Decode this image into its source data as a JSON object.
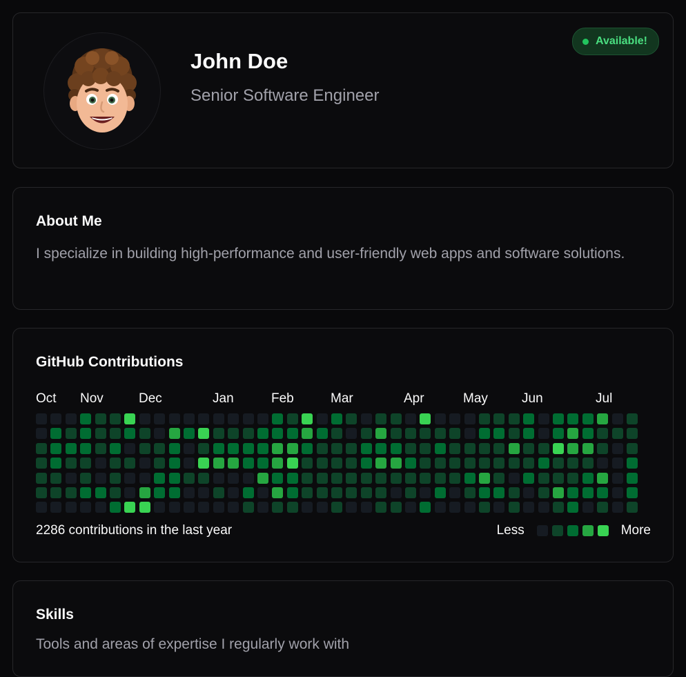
{
  "profile": {
    "name": "John Doe",
    "title": "Senior Software Engineer",
    "status": "Available!",
    "status_color": "#4ade80"
  },
  "about": {
    "heading": "About Me",
    "text": "I specialize in building high-performance and user-friendly web apps and software solutions."
  },
  "github": {
    "heading": "GitHub Contributions",
    "months": [
      "Oct",
      "Nov",
      "Dec",
      "Jan",
      "Feb",
      "Mar",
      "Apr",
      "May",
      "Jun",
      "Jul"
    ],
    "summary": "2286 contributions in the last year",
    "legend_less": "Less",
    "legend_more": "More",
    "level_colors": [
      "#161b22",
      "#0e4429",
      "#006d32",
      "#26a641",
      "#39d353"
    ],
    "weeks": [
      [
        0,
        0,
        1,
        1,
        1,
        1,
        0
      ],
      [
        0,
        2,
        2,
        2,
        1,
        1,
        0
      ],
      [
        0,
        1,
        2,
        1,
        0,
        1,
        0
      ],
      [
        2,
        2,
        2,
        1,
        1,
        2,
        0
      ],
      [
        1,
        1,
        1,
        0,
        0,
        2,
        0
      ],
      [
        1,
        1,
        2,
        1,
        1,
        1,
        2
      ],
      [
        4,
        2,
        0,
        1,
        0,
        0,
        4
      ],
      [
        0,
        1,
        1,
        0,
        0,
        3,
        4
      ],
      [
        0,
        0,
        1,
        1,
        2,
        2,
        0
      ],
      [
        0,
        3,
        2,
        2,
        2,
        2,
        0
      ],
      [
        0,
        2,
        0,
        0,
        1,
        0,
        0
      ],
      [
        0,
        4,
        1,
        4,
        1,
        0,
        0
      ],
      [
        0,
        1,
        2,
        3,
        0,
        1,
        0
      ],
      [
        0,
        1,
        2,
        3,
        0,
        0,
        0
      ],
      [
        0,
        1,
        2,
        2,
        0,
        2,
        1
      ],
      [
        0,
        2,
        2,
        2,
        3,
        0,
        0
      ],
      [
        2,
        2,
        3,
        3,
        2,
        3,
        1
      ],
      [
        1,
        2,
        3,
        4,
        2,
        2,
        1
      ],
      [
        4,
        3,
        2,
        1,
        1,
        1,
        0
      ],
      [
        0,
        2,
        1,
        1,
        1,
        1,
        0
      ],
      [
        2,
        1,
        1,
        1,
        1,
        1,
        1
      ],
      [
        1,
        0,
        1,
        1,
        1,
        1,
        0
      ],
      [
        0,
        1,
        2,
        2,
        1,
        1,
        0
      ],
      [
        1,
        3,
        2,
        3,
        1,
        1,
        1
      ],
      [
        1,
        1,
        2,
        3,
        1,
        0,
        1
      ],
      [
        0,
        1,
        1,
        2,
        1,
        1,
        0
      ],
      [
        4,
        1,
        1,
        1,
        1,
        0,
        2
      ],
      [
        0,
        1,
        2,
        1,
        1,
        2,
        0
      ],
      [
        0,
        1,
        1,
        1,
        1,
        0,
        0
      ],
      [
        0,
        0,
        1,
        1,
        2,
        1,
        0
      ],
      [
        1,
        2,
        1,
        1,
        3,
        2,
        1
      ],
      [
        1,
        2,
        1,
        1,
        1,
        2,
        0
      ],
      [
        1,
        1,
        3,
        1,
        0,
        1,
        1
      ],
      [
        2,
        2,
        1,
        1,
        2,
        0,
        0
      ],
      [
        0,
        0,
        1,
        2,
        1,
        1,
        0
      ],
      [
        2,
        2,
        4,
        1,
        1,
        3,
        1
      ],
      [
        2,
        3,
        3,
        1,
        1,
        2,
        2
      ],
      [
        2,
        2,
        3,
        1,
        2,
        2,
        0
      ],
      [
        3,
        1,
        1,
        0,
        3,
        2,
        1
      ],
      [
        0,
        1,
        0,
        0,
        0,
        0,
        0
      ],
      [
        1,
        1,
        1,
        2,
        2,
        2,
        1
      ]
    ]
  },
  "skills": {
    "heading": "Skills",
    "subtitle": "Tools and areas of expertise I regularly work with"
  }
}
